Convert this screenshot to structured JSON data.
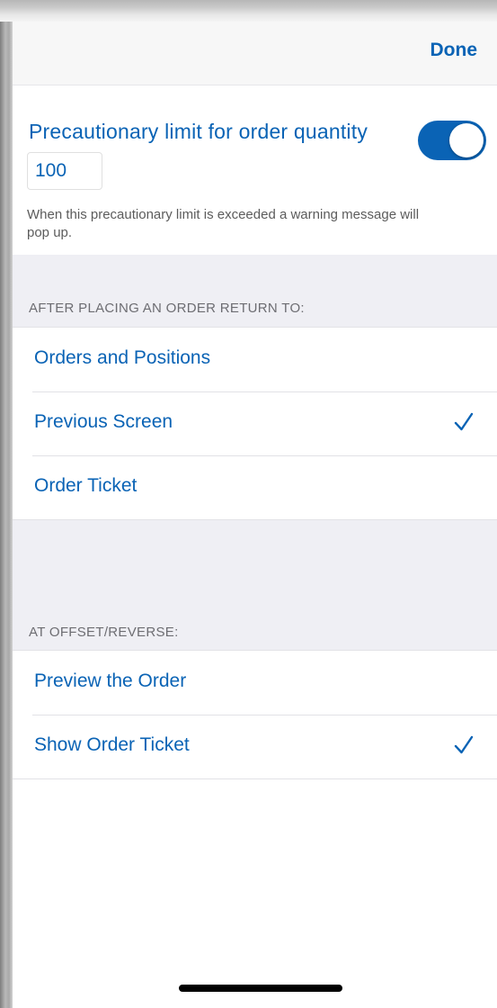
{
  "navbar": {
    "done_label": "Done"
  },
  "precaution": {
    "title": "Precautionary limit for order quantity",
    "enabled": true,
    "quantity": "100",
    "help_text": "When this precautionary limit is exceeded a warning message will pop up."
  },
  "return_section": {
    "header": "AFTER PLACING AN ORDER RETURN TO:",
    "options": [
      {
        "label": "Orders and Positions",
        "selected": false
      },
      {
        "label": "Previous Screen",
        "selected": true
      },
      {
        "label": "Order Ticket",
        "selected": false
      }
    ]
  },
  "offset_section": {
    "header": "AT OFFSET/REVERSE:",
    "options": [
      {
        "label": "Preview the Order",
        "selected": false
      },
      {
        "label": "Show Order Ticket",
        "selected": true
      }
    ]
  },
  "colors": {
    "accent": "#0a63b5",
    "group_background": "#efeff4",
    "secondary_text": "#6d6d72"
  },
  "icons": {
    "checkmark": "checkmark-icon"
  }
}
